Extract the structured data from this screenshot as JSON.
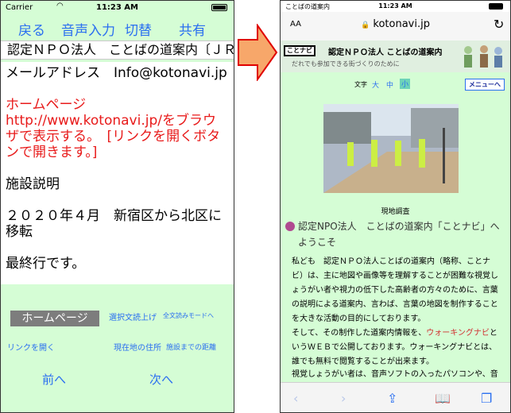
{
  "left": {
    "status": {
      "carrier": "Carrier",
      "time": "11:23 AM"
    },
    "nav": {
      "back": "戻る",
      "voice": "音声入力",
      "toggle": "切替",
      "share": "共有"
    },
    "title": "認定ＮＰＯ法人　ことばの道案内〔ＪＲ",
    "content": {
      "email": "メールアドレス　Info@kotonavi.jp",
      "homepage": "ホームページ　http://www.kotonavi.jp/をブラウザで表示する。　[リンクを開くボタンで開きます。]",
      "section": "施設説明",
      "moved": "２０２０年４月　新宿区から北区に移転",
      "last": "最終行です。"
    },
    "current_item": "ホームページ",
    "buttons": {
      "read_selected": "選択文読上げ",
      "read_all_mode": "全文読みモードへ",
      "open_link": "リンクを開く",
      "current_address": "現在地の住所",
      "distance": "施設までの距離",
      "prev": "前へ",
      "next": "次へ"
    }
  },
  "right": {
    "status": {
      "left": "ことばの道案内",
      "time": "11:23 AM"
    },
    "address_bar": {
      "aa": "AA",
      "url": "kotonavi.jp"
    },
    "banner": {
      "logo": "ことナビ",
      "title": "認定ＮＰＯ法人 ことばの道案内",
      "subtitle": "だれでも参加できる街づくりのために"
    },
    "text_size": {
      "label": "文字",
      "large": "大",
      "medium": "中",
      "small": "小"
    },
    "menu_button": "メニューへ",
    "photo_caption": "現地調査",
    "heading": "認定NPO法人　ことばの道案内「ことナビ」へようこそ",
    "para1": "私ども　認定ＮＰＯ法人ことばの道案内（略称、ことナビ）は、主に地図や画像等を理解することが困難な視覚しょうがい者や視力の低下した高齢者の方々のために、言葉の説明による道案内、言わば、言葉の地図を制作することを大きな活動の目的にしております。",
    "para2_a": "そして、その制作した道案内情報を、",
    "para2_link": "ウォーキングナビ",
    "para2_b": "というＷＥＢで公開しております。ウォーキングナビとは、誰でも無料で閲覧することが出来ます。",
    "para3": "視覚しょうがい者は、音声ソフトの入ったパソコンや、音声"
  },
  "colors": {
    "background_green": "#d5fdd5",
    "link_blue": "#2a6ff0",
    "alert_red": "#e81a1a",
    "arrow_orange": "#f7a76a",
    "arrow_stroke": "#e00000"
  }
}
